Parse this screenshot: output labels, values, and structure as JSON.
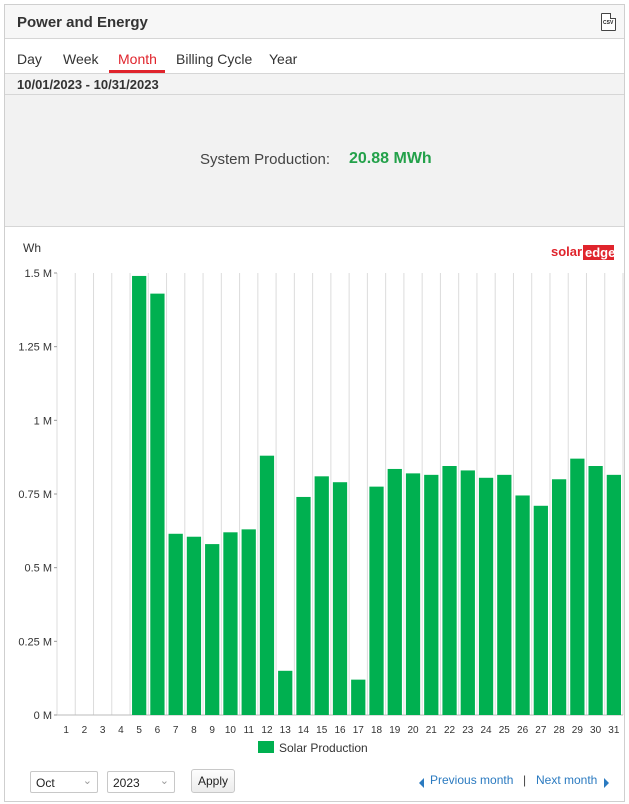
{
  "header": {
    "title": "Power and Energy",
    "csv_icon": "csv-file-icon",
    "csv_label": "CSV"
  },
  "tabs": [
    {
      "label": "Day",
      "active": false
    },
    {
      "label": "Week",
      "active": false
    },
    {
      "label": "Month",
      "active": true
    },
    {
      "label": "Billing Cycle",
      "active": false
    },
    {
      "label": "Year",
      "active": false
    }
  ],
  "date_range": "10/01/2023 - 10/31/2023",
  "summary": {
    "label": "System Production:",
    "value": "20.88 MWh"
  },
  "brand": {
    "solar": "solar",
    "edge": "edge"
  },
  "colors": {
    "bar": "#00b050",
    "accent": "#e0242c",
    "value": "#23a14a",
    "link": "#2a7ac0"
  },
  "chart_data": {
    "type": "bar",
    "ylabel": "Wh",
    "ylim": [
      0,
      1500000
    ],
    "yticks": [
      {
        "value": 0,
        "label": "0 M"
      },
      {
        "value": 250000,
        "label": "0.25 M"
      },
      {
        "value": 500000,
        "label": "0.5 M"
      },
      {
        "value": 750000,
        "label": "0.75 M"
      },
      {
        "value": 1000000,
        "label": "1 M"
      },
      {
        "value": 1250000,
        "label": "1.25 M"
      },
      {
        "value": 1500000,
        "label": "1.5 M"
      }
    ],
    "grid": "vertical",
    "legend_position": "bottom",
    "categories": [
      "1",
      "2",
      "3",
      "4",
      "5",
      "6",
      "7",
      "8",
      "9",
      "10",
      "11",
      "12",
      "13",
      "14",
      "15",
      "16",
      "17",
      "18",
      "19",
      "20",
      "21",
      "22",
      "23",
      "24",
      "25",
      "26",
      "27",
      "28",
      "29",
      "30",
      "31"
    ],
    "series": [
      {
        "name": "Solar Production",
        "values": [
          0,
          0,
          0,
          0,
          1490000,
          1430000,
          615000,
          605000,
          580000,
          620000,
          630000,
          880000,
          150000,
          740000,
          810000,
          790000,
          120000,
          775000,
          835000,
          820000,
          815000,
          845000,
          830000,
          805000,
          815000,
          745000,
          710000,
          800000,
          870000,
          845000,
          815000
        ]
      }
    ]
  },
  "footer": {
    "month_value": "Oct",
    "year_value": "2023",
    "apply_label": "Apply",
    "prev_label": "Previous month",
    "separator": "|",
    "next_label": "Next month"
  }
}
